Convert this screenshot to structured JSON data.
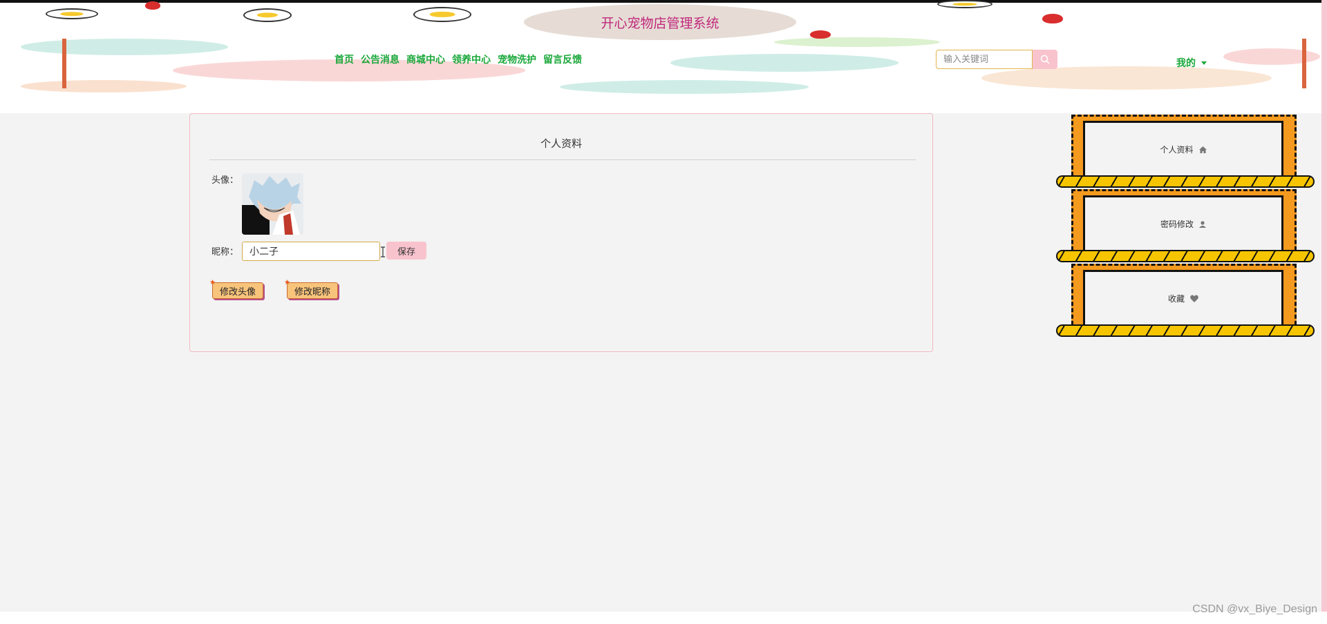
{
  "app": {
    "title": "开心宠物店管理系统"
  },
  "nav": {
    "items": [
      "首页",
      "公告消息",
      "商城中心",
      "领养中心",
      "宠物洗护",
      "留言反馈"
    ]
  },
  "search": {
    "placeholder": "输入关键词",
    "icon": "search-icon"
  },
  "user_menu": {
    "label": "我的",
    "icon": "chevron-down-icon"
  },
  "profile": {
    "title": "个人资料",
    "avatar_label": "头像：",
    "nickname_label": "昵称：",
    "nickname_value": "小二子",
    "save_label": "保存",
    "change_avatar_label": "修改头像",
    "change_nickname_label": "修改昵称"
  },
  "side_menu": {
    "items": [
      {
        "label": "个人资料",
        "icon": "home-icon"
      },
      {
        "label": "密码修改",
        "icon": "user-icon"
      },
      {
        "label": "收藏",
        "icon": "heart-icon"
      }
    ]
  },
  "watermark": "CSDN @vx_Biye_Design",
  "colors": {
    "nav_green": "#1aa83a",
    "title_magenta": "#c0287c",
    "accent_pink": "#f8c3cd",
    "menu_orange": "#f39a1f",
    "rope_yellow": "#f7c500"
  }
}
